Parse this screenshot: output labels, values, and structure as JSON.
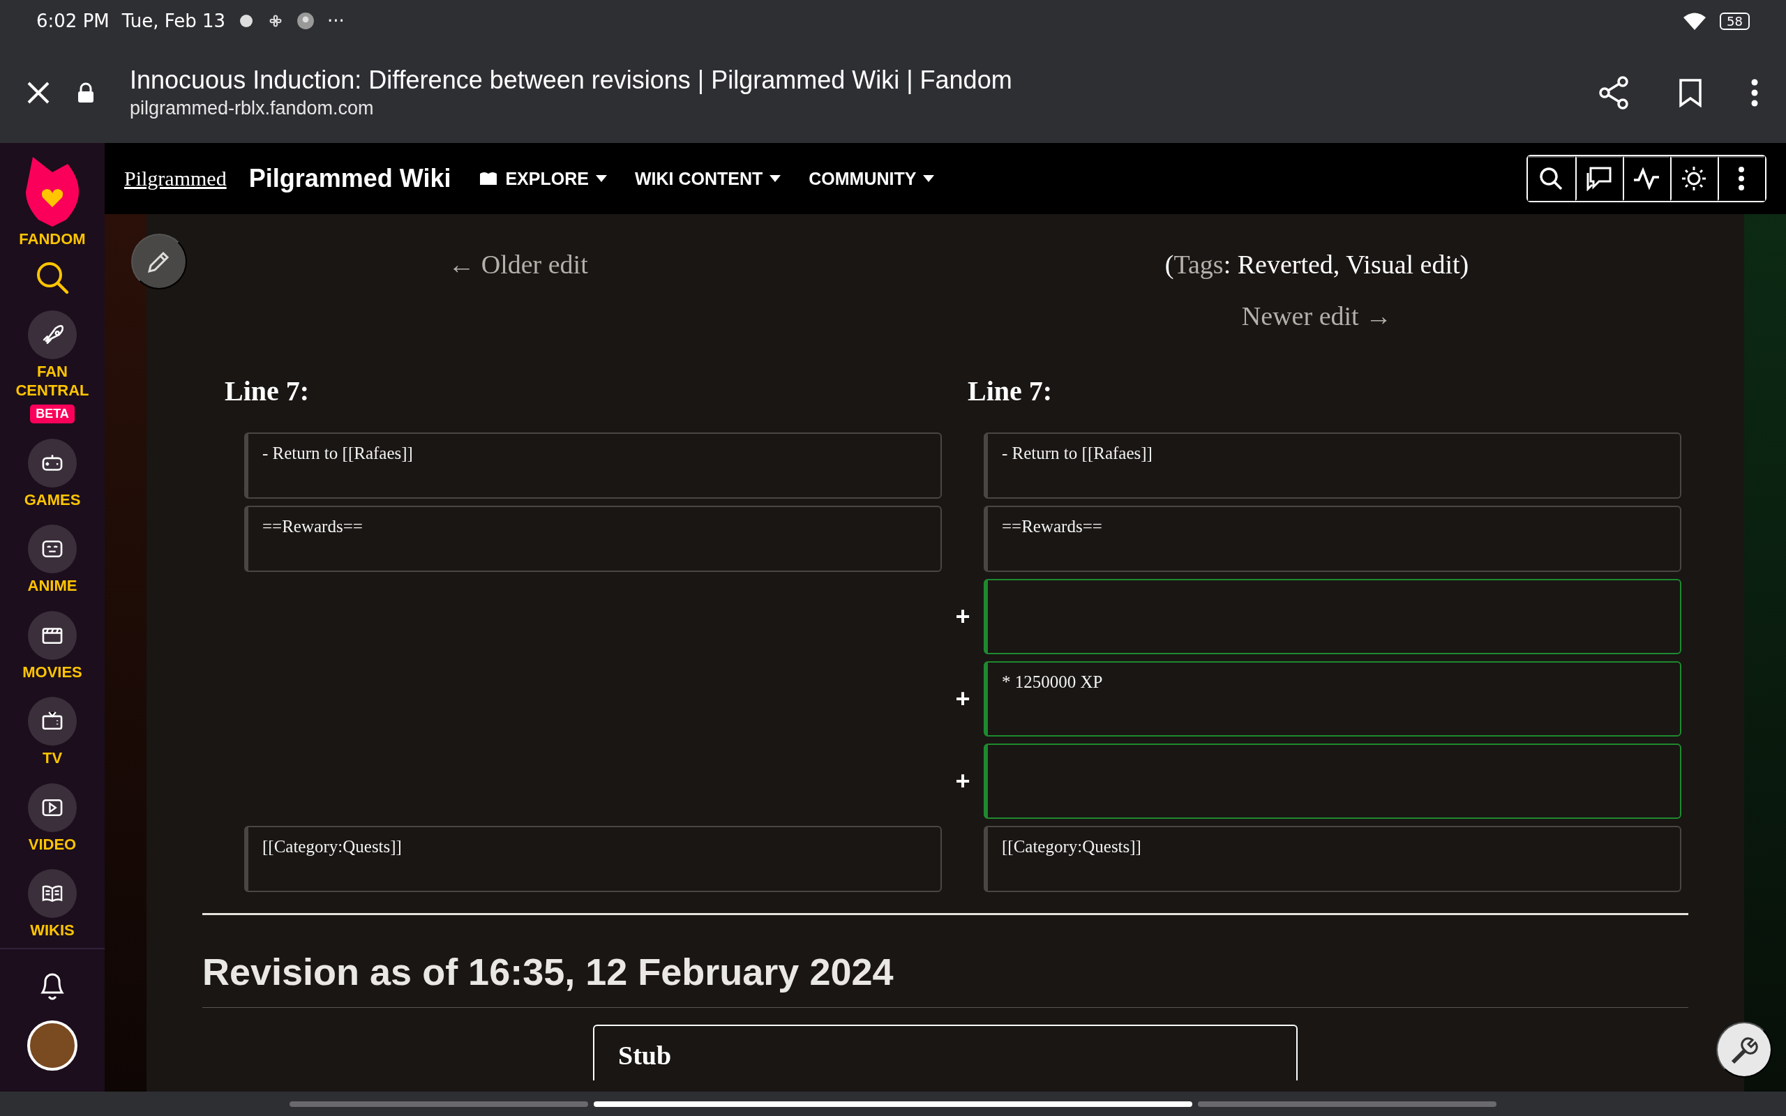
{
  "status_bar": {
    "time": "6:02 PM",
    "date": "Tue, Feb 13",
    "more": "···",
    "battery": "58"
  },
  "browser": {
    "title": "Innocuous Induction: Difference between revisions | Pilgrammed Wiki | Fandom",
    "url": "pilgrammed-rblx.fandom.com"
  },
  "sidebar": {
    "logo_label": "FANDOM",
    "items": [
      {
        "label": "FAN CENTRAL",
        "badge": "BETA"
      },
      {
        "label": "GAMES"
      },
      {
        "label": "ANIME"
      },
      {
        "label": "MOVIES"
      },
      {
        "label": "TV"
      },
      {
        "label": "VIDEO"
      },
      {
        "label": "WIKIS"
      }
    ]
  },
  "navbar": {
    "wordmark": "Pilgrammed",
    "wiki_name": "Pilgrammed Wiki",
    "menus": [
      "EXPLORE",
      "WIKI CONTENT",
      "COMMUNITY"
    ]
  },
  "diff": {
    "older_link": "← Older edit",
    "tags_line": {
      "before": "(",
      "link": "Tags",
      "after": ": Reverted, Visual edit)"
    },
    "newer_link": "Newer edit →",
    "left_heading": "Line 7:",
    "right_heading": "Line 7:",
    "rows": [
      {
        "kind": "context",
        "left": "- Return to [[Rafaes]]",
        "right": "- Return to [[Rafaes]]"
      },
      {
        "kind": "context",
        "left": "==Rewards==",
        "right": "==Rewards=="
      },
      {
        "kind": "added",
        "marker": "+"
      },
      {
        "kind": "added",
        "marker": "+",
        "right": "* 1250000 XP"
      },
      {
        "kind": "added",
        "marker": "+"
      },
      {
        "kind": "context",
        "left": "[[Category:Quests]]",
        "right": "[[Category:Quests]]"
      }
    ]
  },
  "revision_heading": "Revision as of 16:35, 12 February 2024",
  "stub_title": "Stub"
}
